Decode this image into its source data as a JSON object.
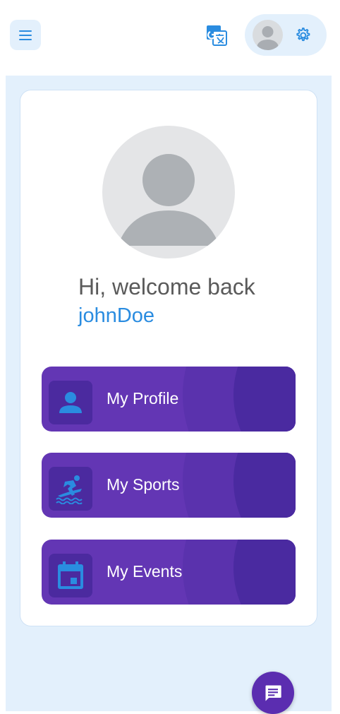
{
  "header": {
    "menu_icon": "menu-icon",
    "translate_icon": "translate-icon",
    "avatar_icon": "avatar-icon",
    "settings_icon": "gear-icon"
  },
  "profile": {
    "greeting": "Hi, welcome back",
    "username": "johnDoe"
  },
  "actions": [
    {
      "label": "My Profile",
      "icon": "person-icon"
    },
    {
      "label": "My Sports",
      "icon": "surfing-icon"
    },
    {
      "label": "My Events",
      "icon": "calendar-icon"
    }
  ],
  "fab": {
    "icon": "chat-icon"
  },
  "colors": {
    "accent": "#2a8ce0",
    "header_pill": "#e3f0fc",
    "action_bg": "#6336b4",
    "fab_bg": "#5b2db0"
  }
}
